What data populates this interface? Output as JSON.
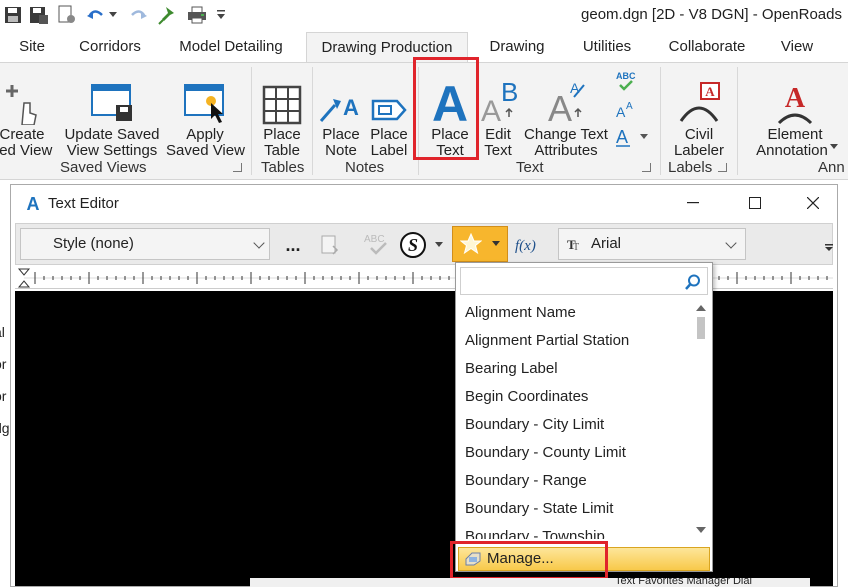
{
  "window_title": "geom.dgn [2D - V8 DGN] - OpenRoads",
  "quick_access": [
    "folder-open-icon",
    "save-icon",
    "save-settings-icon",
    "undo-icon",
    "undo-dropdown-icon",
    "redo-icon",
    "pin-icon",
    "print-icon",
    "customize-icon"
  ],
  "tabs": [
    "Site",
    "Corridors",
    "Model Detailing",
    "Drawing Production",
    "Drawing",
    "Utilities",
    "Collaborate",
    "View"
  ],
  "active_tab": "Drawing Production",
  "ribbon": {
    "saved_views": {
      "group": "Saved Views",
      "create": "Create\nSaved View",
      "create_l1": "Create",
      "create_l2": "ved View",
      "update_l1": "Update Saved",
      "update_l2": "View Settings",
      "apply_l1": "Apply",
      "apply_l2": "Saved View"
    },
    "tables": {
      "group": "Tables",
      "l1": "Place",
      "l2": "Table"
    },
    "notes": {
      "group": "Notes",
      "note_l1": "Place",
      "note_l2": "Note",
      "label_l1": "Place",
      "label_l2": "Label"
    },
    "text": {
      "group": "Text",
      "place_l1": "Place",
      "place_l2": "Text",
      "edit_l1": "Edit",
      "edit_l2": "Text",
      "change_l1": "Change Text",
      "change_l2": "Attributes"
    },
    "labels": {
      "group": "Labels",
      "civil_l1": "Civil",
      "civil_l2": "Labeler"
    },
    "annotation": {
      "group": "Ann",
      "el_l1": "Element",
      "el_l2": "Annotation"
    }
  },
  "text_editor": {
    "title": "Text Editor",
    "style_value": "Style (none)",
    "more_label": "...",
    "font_value": "Arial"
  },
  "dropdown": {
    "search_placeholder": "",
    "items": [
      "Alignment Name",
      "Alignment Partial Station",
      "Bearing Label",
      "Begin Coordinates",
      "Boundary - City Limit",
      "Boundary - County Limit",
      "Boundary - Range",
      "Boundary - State Limit",
      "Boundary - Township"
    ],
    "manage_label": "Manage..."
  },
  "left_fragments": [
    "al",
    "or",
    "or",
    "dg"
  ],
  "status_fragment": "Text Favorites Manager Dial"
}
